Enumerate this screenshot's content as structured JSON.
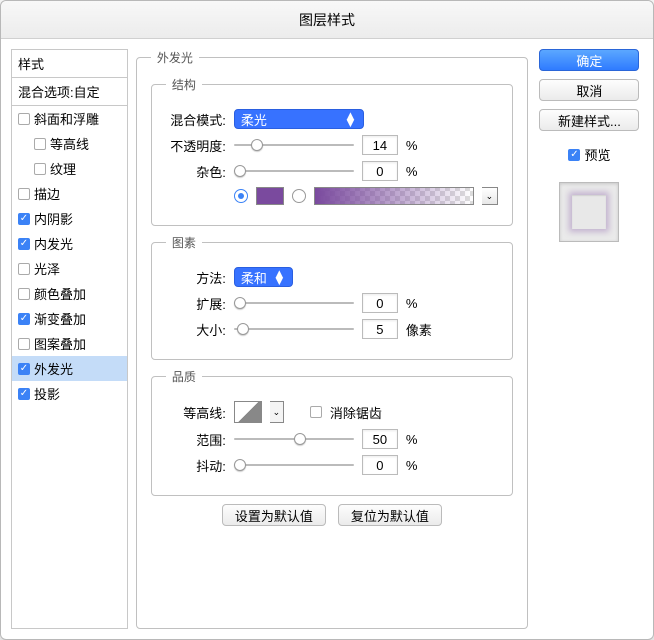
{
  "title": "图层样式",
  "sidebar": {
    "header": "样式",
    "blend": "混合选项:自定",
    "items": [
      {
        "label": "斜面和浮雕",
        "checked": false,
        "indent": false
      },
      {
        "label": "等高线",
        "checked": false,
        "indent": true
      },
      {
        "label": "纹理",
        "checked": false,
        "indent": true
      },
      {
        "label": "描边",
        "checked": false,
        "indent": false
      },
      {
        "label": "内阴影",
        "checked": true,
        "indent": false
      },
      {
        "label": "内发光",
        "checked": true,
        "indent": false
      },
      {
        "label": "光泽",
        "checked": false,
        "indent": false
      },
      {
        "label": "颜色叠加",
        "checked": false,
        "indent": false
      },
      {
        "label": "渐变叠加",
        "checked": true,
        "indent": false
      },
      {
        "label": "图案叠加",
        "checked": false,
        "indent": false
      },
      {
        "label": "外发光",
        "checked": true,
        "indent": false,
        "selected": true
      },
      {
        "label": "投影",
        "checked": true,
        "indent": false
      }
    ]
  },
  "panel": {
    "outer_legend": "外发光",
    "struct_legend": "结构",
    "blendmode_label": "混合模式:",
    "blendmode_value": "柔光",
    "opacity_label": "不透明度:",
    "opacity_value": "14",
    "opacity_unit": "%",
    "noise_label": "杂色:",
    "noise_value": "0",
    "noise_unit": "%",
    "color_hex": "#7a4a9e",
    "elements_legend": "图素",
    "tech_label": "方法:",
    "tech_value": "柔和",
    "spread_label": "扩展:",
    "spread_value": "0",
    "spread_unit": "%",
    "size_label": "大小:",
    "size_value": "5",
    "size_unit": "像素",
    "quality_legend": "品质",
    "contour_label": "等高线:",
    "antialias_label": "消除锯齿",
    "range_label": "范围:",
    "range_value": "50",
    "range_unit": "%",
    "jitter_label": "抖动:",
    "jitter_value": "0",
    "jitter_unit": "%",
    "set_default": "设置为默认值",
    "reset_default": "复位为默认值"
  },
  "right": {
    "ok": "确定",
    "cancel": "取消",
    "newstyle": "新建样式...",
    "preview_label": "预览"
  }
}
